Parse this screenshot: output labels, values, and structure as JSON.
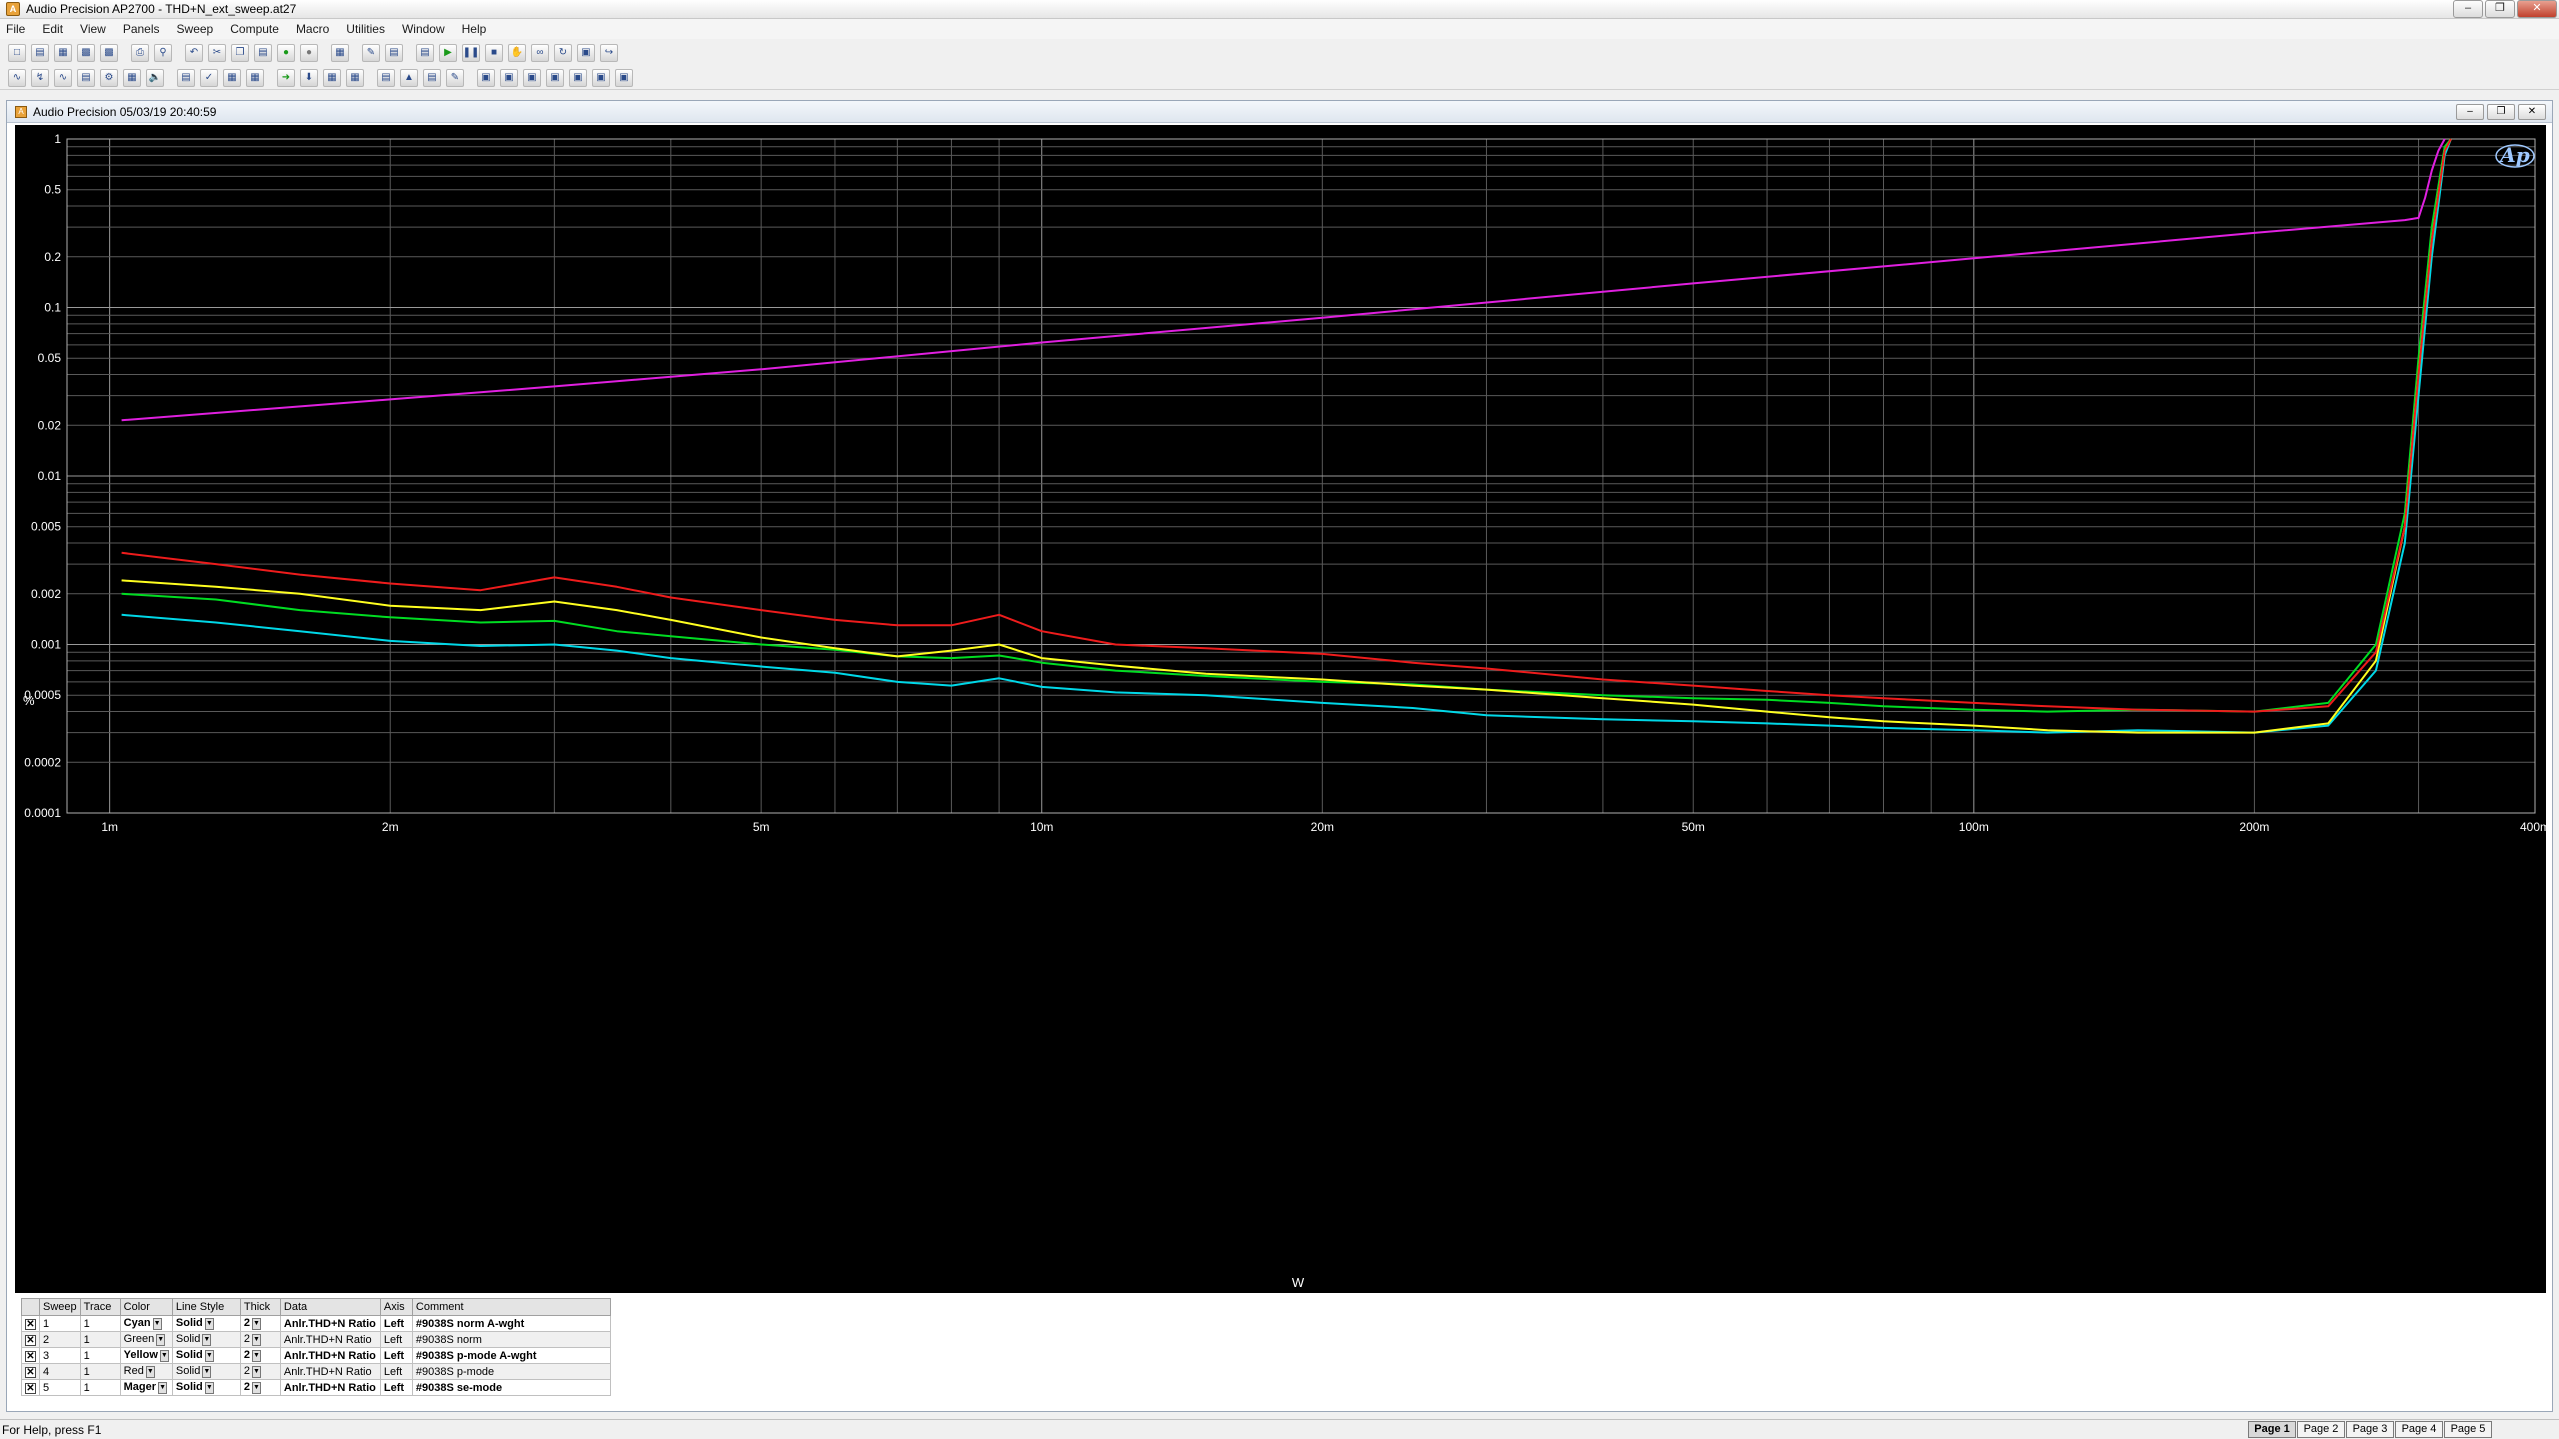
{
  "window": {
    "title": "Audio Precision AP2700 - THD+N_ext_sweep.at27"
  },
  "menus": [
    "File",
    "Edit",
    "View",
    "Panels",
    "Sweep",
    "Compute",
    "Macro",
    "Utilities",
    "Window",
    "Help"
  ],
  "graph_window": {
    "title": "Audio Precision  05/03/19 20:40:59",
    "logo": "Ap"
  },
  "chart_data": {
    "type": "line",
    "xlabel": "W",
    "ylabel": "%",
    "xscale": "log",
    "yscale": "log",
    "xlim": [
      0.0009,
      0.4
    ],
    "ylim": [
      0.0001,
      1
    ],
    "grid": true,
    "x_ticks": [
      {
        "v": 0.001,
        "label": "1m"
      },
      {
        "v": 0.002,
        "label": "2m"
      },
      {
        "v": 0.005,
        "label": "5m"
      },
      {
        "v": 0.01,
        "label": "10m"
      },
      {
        "v": 0.02,
        "label": "20m"
      },
      {
        "v": 0.05,
        "label": "50m"
      },
      {
        "v": 0.1,
        "label": "100m"
      },
      {
        "v": 0.2,
        "label": "200m"
      },
      {
        "v": 0.4,
        "label": "400m"
      }
    ],
    "y_ticks": [
      {
        "v": 1,
        "label": "1"
      },
      {
        "v": 0.5,
        "label": "0.5"
      },
      {
        "v": 0.2,
        "label": "0.2"
      },
      {
        "v": 0.1,
        "label": "0.1"
      },
      {
        "v": 0.05,
        "label": "0.05"
      },
      {
        "v": 0.02,
        "label": "0.02"
      },
      {
        "v": 0.01,
        "label": "0.01"
      },
      {
        "v": 0.005,
        "label": "0.005"
      },
      {
        "v": 0.002,
        "label": "0.002"
      },
      {
        "v": 0.001,
        "label": "0.001"
      },
      {
        "v": 0.0005,
        "label": "0.0005"
      },
      {
        "v": 0.0002,
        "label": "0.0002"
      },
      {
        "v": 0.0001,
        "label": "0.0001"
      }
    ],
    "series": [
      {
        "color": "#00d8e8",
        "x": [
          0.00103,
          0.0013,
          0.0016,
          0.002,
          0.0025,
          0.003,
          0.0035,
          0.004,
          0.005,
          0.006,
          0.007,
          0.008,
          0.009,
          0.01,
          0.012,
          0.015,
          0.02,
          0.025,
          0.03,
          0.04,
          0.05,
          0.06,
          0.07,
          0.08,
          0.1,
          0.12,
          0.15,
          0.2,
          0.24,
          0.27,
          0.29,
          0.3,
          0.31,
          0.32,
          0.325
        ],
        "y": [
          0.0015,
          0.00135,
          0.0012,
          0.00105,
          0.00098,
          0.001,
          0.00092,
          0.00083,
          0.00074,
          0.00068,
          0.0006,
          0.00057,
          0.00063,
          0.00056,
          0.00052,
          0.0005,
          0.00045,
          0.00042,
          0.00038,
          0.00036,
          0.00035,
          0.00034,
          0.00033,
          0.00032,
          0.00031,
          0.0003,
          0.00031,
          0.0003,
          0.00033,
          0.0007,
          0.004,
          0.03,
          0.2,
          0.8,
          1
        ]
      },
      {
        "color": "#00dd22",
        "x": [
          0.00103,
          0.0013,
          0.0016,
          0.002,
          0.0025,
          0.003,
          0.0035,
          0.004,
          0.005,
          0.006,
          0.007,
          0.008,
          0.009,
          0.01,
          0.012,
          0.015,
          0.02,
          0.025,
          0.03,
          0.04,
          0.05,
          0.06,
          0.07,
          0.08,
          0.1,
          0.12,
          0.15,
          0.2,
          0.24,
          0.27,
          0.29,
          0.3,
          0.31,
          0.32,
          0.325
        ],
        "y": [
          0.002,
          0.00185,
          0.0016,
          0.00145,
          0.00135,
          0.00138,
          0.0012,
          0.00112,
          0.001,
          0.00093,
          0.00085,
          0.00083,
          0.00086,
          0.00078,
          0.0007,
          0.00065,
          0.0006,
          0.00058,
          0.00054,
          0.0005,
          0.00048,
          0.00047,
          0.00045,
          0.00043,
          0.00041,
          0.0004,
          0.00041,
          0.0004,
          0.00045,
          0.001,
          0.006,
          0.05,
          0.3,
          0.9,
          1
        ]
      },
      {
        "color": "#ffff20",
        "x": [
          0.00103,
          0.0013,
          0.0016,
          0.002,
          0.0025,
          0.003,
          0.0035,
          0.004,
          0.005,
          0.006,
          0.007,
          0.008,
          0.009,
          0.01,
          0.012,
          0.015,
          0.02,
          0.025,
          0.03,
          0.04,
          0.05,
          0.06,
          0.07,
          0.08,
          0.1,
          0.12,
          0.15,
          0.2,
          0.24,
          0.27,
          0.29,
          0.3,
          0.31,
          0.32,
          0.325
        ],
        "y": [
          0.0024,
          0.0022,
          0.002,
          0.0017,
          0.0016,
          0.0018,
          0.0016,
          0.0014,
          0.0011,
          0.00095,
          0.00085,
          0.00092,
          0.001,
          0.00083,
          0.00075,
          0.00067,
          0.00062,
          0.00057,
          0.00054,
          0.00048,
          0.00044,
          0.0004,
          0.00037,
          0.00035,
          0.00033,
          0.00031,
          0.0003,
          0.0003,
          0.00034,
          0.0008,
          0.005,
          0.04,
          0.25,
          0.85,
          1
        ]
      },
      {
        "color": "#ee1c1c",
        "x": [
          0.00103,
          0.0013,
          0.0016,
          0.002,
          0.0025,
          0.003,
          0.0035,
          0.004,
          0.005,
          0.006,
          0.007,
          0.008,
          0.009,
          0.01,
          0.012,
          0.015,
          0.02,
          0.025,
          0.03,
          0.04,
          0.05,
          0.06,
          0.07,
          0.08,
          0.1,
          0.12,
          0.15,
          0.2,
          0.24,
          0.27,
          0.29,
          0.3,
          0.31,
          0.32,
          0.325
        ],
        "y": [
          0.0035,
          0.003,
          0.0026,
          0.0023,
          0.0021,
          0.0025,
          0.0022,
          0.0019,
          0.0016,
          0.0014,
          0.0013,
          0.0013,
          0.0015,
          0.0012,
          0.001,
          0.00095,
          0.00088,
          0.00078,
          0.00072,
          0.00062,
          0.00057,
          0.00053,
          0.0005,
          0.00048,
          0.00045,
          0.00043,
          0.00041,
          0.0004,
          0.00043,
          0.0009,
          0.005,
          0.04,
          0.25,
          0.85,
          1
        ]
      },
      {
        "color": "#e020e0",
        "x": [
          0.00103,
          0.002,
          0.003,
          0.005,
          0.01,
          0.02,
          0.05,
          0.1,
          0.2,
          0.29,
          0.3,
          0.305,
          0.31,
          0.315,
          0.32
        ],
        "y": [
          0.0214,
          0.0285,
          0.034,
          0.043,
          0.062,
          0.087,
          0.139,
          0.196,
          0.277,
          0.33,
          0.34,
          0.45,
          0.65,
          0.85,
          1
        ]
      }
    ]
  },
  "legend_table": {
    "headers": [
      "Sweep",
      "Trace",
      "Color",
      "Line Style",
      "Thick",
      "Data",
      "Axis",
      "Comment"
    ],
    "rows": [
      {
        "checked": "✕",
        "sweep": "1",
        "trace": "1",
        "color": "Cyan",
        "style": "Solid",
        "thick": "2",
        "data": "Anlr.THD+N Ratio",
        "axis": "Left",
        "comment": "#9038S norm A-wght",
        "bold": true
      },
      {
        "checked": "✕",
        "sweep": "2",
        "trace": "1",
        "color": "Green",
        "style": "Solid",
        "thick": "2",
        "data": "Anlr.THD+N Ratio",
        "axis": "Left",
        "comment": "#9038S norm",
        "bold": false
      },
      {
        "checked": "✕",
        "sweep": "3",
        "trace": "1",
        "color": "Yellow",
        "style": "Solid",
        "thick": "2",
        "data": "Anlr.THD+N Ratio",
        "axis": "Left",
        "comment": "#9038S p-mode A-wght",
        "bold": true
      },
      {
        "checked": "✕",
        "sweep": "4",
        "trace": "1",
        "color": "Red",
        "style": "Solid",
        "thick": "2",
        "data": "Anlr.THD+N Ratio",
        "axis": "Left",
        "comment": "#9038S p-mode",
        "bold": false
      },
      {
        "checked": "✕",
        "sweep": "5",
        "trace": "1",
        "color": "Mager",
        "style": "Solid",
        "thick": "2",
        "data": "Anlr.THD+N Ratio",
        "axis": "Left",
        "comment": "#9038S se-mode",
        "bold": true
      }
    ]
  },
  "statusbar": {
    "text": "For Help, press F1",
    "pages": [
      "Page 1",
      "Page 2",
      "Page 3",
      "Page 4",
      "Page 5"
    ],
    "active_page": "Page 1"
  }
}
